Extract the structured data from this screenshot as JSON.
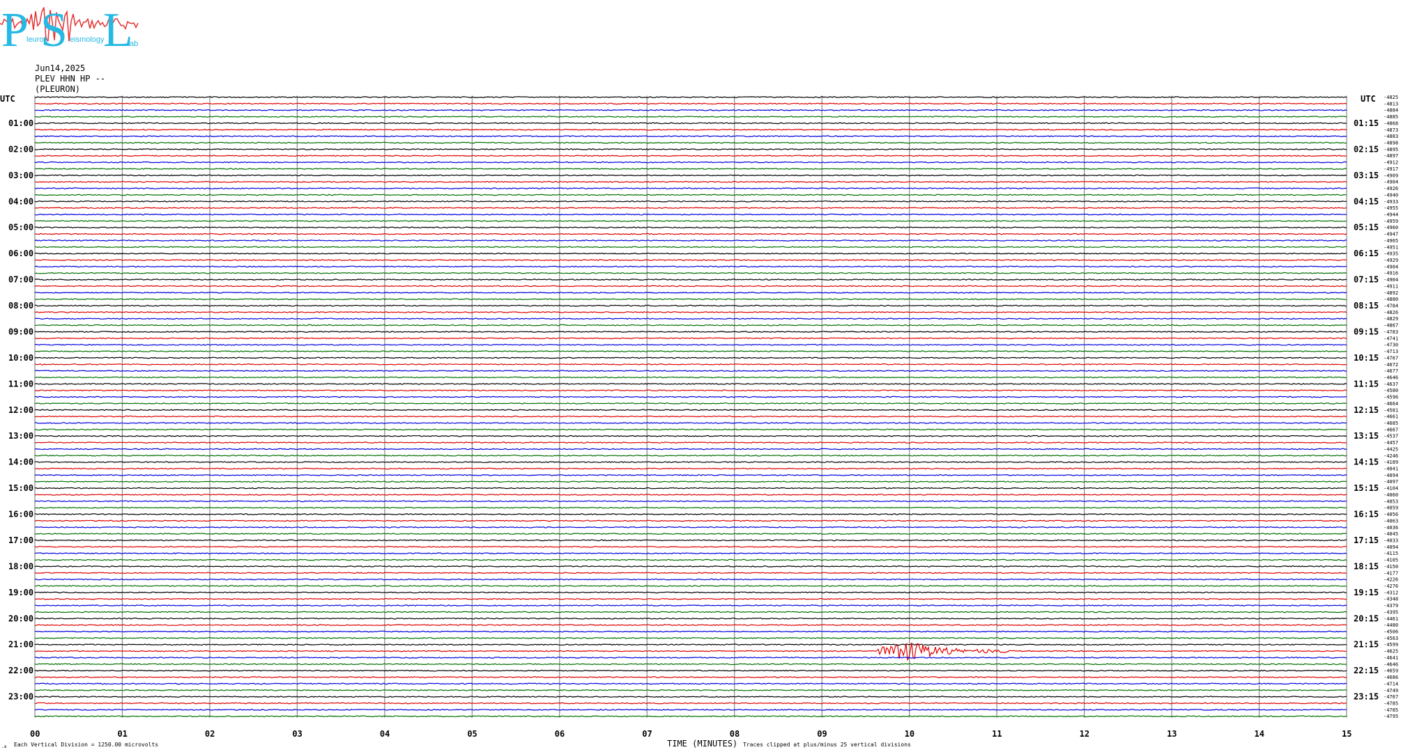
{
  "logo": {
    "letters": [
      "P",
      "S",
      "L"
    ],
    "small_words": [
      "leuron",
      "eismology",
      "ab"
    ]
  },
  "header": {
    "date": "Jun14,2025",
    "station": "PLEV HHN HP --",
    "location": "(PLEURON)"
  },
  "colors": {
    "trace_cycle": [
      "#000000",
      "#e00000",
      "#0000e0",
      "#007000"
    ],
    "grid": "#888888",
    "logo_blue": "#27b8e3",
    "logo_red": "#e83030"
  },
  "chart_data": {
    "type": "line",
    "title": "",
    "xlabel": "TIME (MINUTES)",
    "ylabel": "",
    "xlim": [
      0,
      15
    ],
    "x_ticks": [
      "00",
      "01",
      "02",
      "03",
      "04",
      "05",
      "06",
      "07",
      "08",
      "09",
      "10",
      "11",
      "12",
      "13",
      "14",
      "15"
    ],
    "left_axis_title": "UTC",
    "right_axis_title": "UTC",
    "left_hour_labels": [
      "01:00",
      "02:00",
      "03:00",
      "04:00",
      "05:00",
      "06:00",
      "07:00",
      "08:00",
      "09:00",
      "10:00",
      "11:00",
      "12:00",
      "13:00",
      "14:00",
      "15:00",
      "16:00",
      "17:00",
      "18:00",
      "19:00",
      "20:00",
      "21:00",
      "22:00",
      "23:00"
    ],
    "right_hour_labels": [
      "01:15",
      "02:15",
      "03:15",
      "04:15",
      "05:15",
      "06:15",
      "07:15",
      "08:15",
      "09:15",
      "10:15",
      "11:15",
      "12:15",
      "13:15",
      "14:15",
      "15:15",
      "16:15",
      "17:15",
      "18:15",
      "19:15",
      "20:15",
      "21:15",
      "22:15",
      "23:15"
    ],
    "trace_offsets": [
      -4825,
      -4813,
      -4884,
      -4885,
      -4868,
      -4873,
      -4883,
      -4898,
      -4895,
      -4897,
      -4912,
      -4917,
      -4909,
      -4904,
      -4926,
      -4940,
      -4933,
      -4955,
      -4944,
      -4959,
      -4960,
      -4947,
      -4965,
      -4951,
      -4935,
      -4929,
      -4904,
      -4916,
      -4904,
      -4911,
      -4892,
      -4880,
      -4784,
      -4826,
      -4829,
      -4867,
      -4783,
      -4741,
      -4730,
      -4713,
      -4767,
      -4672,
      -4677,
      -4646,
      -4637,
      -4580,
      -4596,
      -4664,
      -4581,
      -4661,
      -4685,
      -4667,
      -4537,
      -4457,
      -4425,
      -4246,
      -4189,
      -4041,
      -4094,
      -4097,
      -4104,
      -4060,
      -4053,
      -4059,
      -4056,
      -4063,
      -4036,
      -4045,
      -4033,
      -4094,
      -4115,
      -4105,
      -4150,
      -4177,
      -4226,
      -4276,
      -4312,
      -4348,
      -4379,
      -4395,
      -4461,
      -4480,
      -4506,
      -4563,
      -4599,
      -4625,
      -4641,
      -4646,
      -4659,
      -4686,
      -4714,
      -4749,
      -4767,
      -4785,
      -4785,
      -4795
    ],
    "event": {
      "trace_index": 85,
      "start_minute": 9.6,
      "peak_minute": 9.96,
      "end_minute": 11.2
    },
    "footer_left": "Each Vertical Division = 1250.00 microvolts",
    "footer_right": "Traces clipped at plus/minus 25 vertical divisions",
    "footer_tiny": ".a"
  }
}
